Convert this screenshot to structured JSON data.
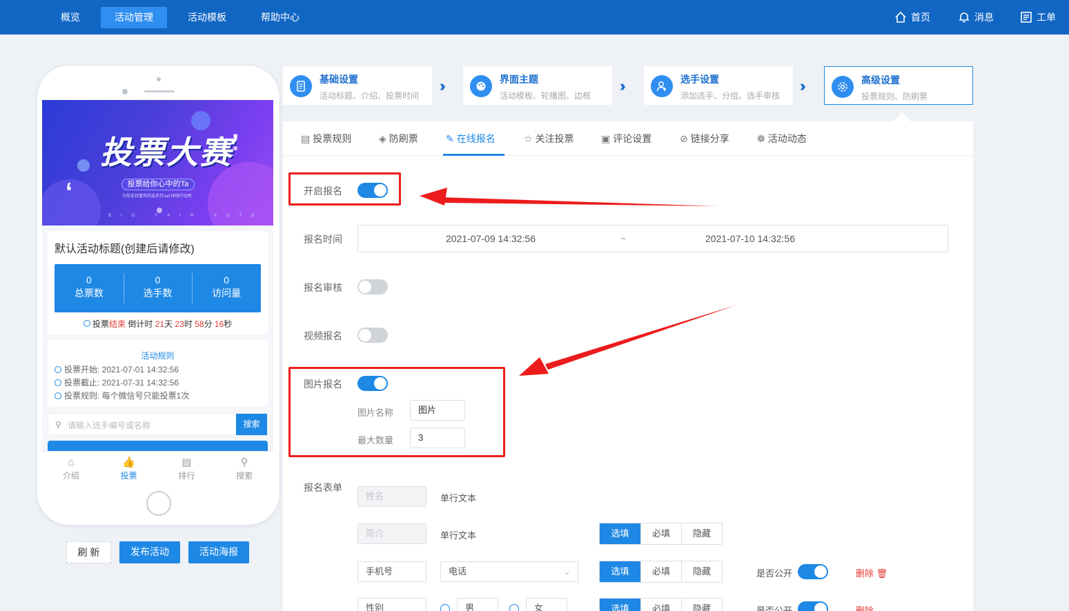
{
  "topnav": {
    "items": [
      "概览",
      "活动管理",
      "活动模板",
      "帮助中心"
    ],
    "active_index": 1,
    "right": {
      "home": "首页",
      "messages": "消息",
      "tickets": "工单"
    }
  },
  "phone": {
    "banner": {
      "title": "投票大赛",
      "pill": "投票给你心中的Ta",
      "sub": "为你支持喜欢的选手打call 快快行动吧",
      "footer": "BIG FAIR VOTE"
    },
    "activity_title": "默认活动标题(创建后请修改)",
    "stats": [
      {
        "value": "0",
        "label": "总票数"
      },
      {
        "value": "0",
        "label": "选手数"
      },
      {
        "value": "0",
        "label": "访问量"
      }
    ],
    "countdown": {
      "prefix": "投票",
      "status": "结束",
      "label": "倒计时",
      "days": "21",
      "days_unit": "天",
      "hours": "23",
      "hours_unit": "时",
      "minutes": "58",
      "minutes_unit": "分",
      "seconds": "16",
      "seconds_unit": "秒"
    },
    "rules": {
      "title": "活动规则",
      "start": "投票开始: 2021-07-01 14:32:56",
      "end": "投票截止: 2021-07-31 14:32:56",
      "rule": "投票规则: 每个微信号只能投票1次"
    },
    "search": {
      "placeholder": "请输入选手编号或名称",
      "button": "搜索"
    },
    "tabbar": [
      "介绍",
      "投票",
      "排行",
      "搜索"
    ]
  },
  "actions": {
    "refresh": "刷 新",
    "publish": "发布活动",
    "poster": "活动海报"
  },
  "steps": [
    {
      "title": "基础设置",
      "desc": "活动标题、介绍、投票时间"
    },
    {
      "title": "界面主题",
      "desc": "活动模板、轮播图、边框"
    },
    {
      "title": "选手设置",
      "desc": "添加选手、分组、选手审核"
    },
    {
      "title": "高级设置",
      "desc": "投票规则、防刷票"
    }
  ],
  "tabs": [
    "投票规则",
    "防刷票",
    "在线报名",
    "关注投票",
    "评论设置",
    "链接分享",
    "活动动态"
  ],
  "active_tab": 2,
  "form": {
    "enable_signup": {
      "label": "开启报名",
      "on": true
    },
    "signup_time": {
      "label": "报名时间",
      "start": "2021-07-09 14:32:56",
      "sep": "~",
      "end": "2021-07-10 14:32:56"
    },
    "review": {
      "label": "报名审核",
      "on": false
    },
    "video": {
      "label": "视频报名",
      "on": false
    },
    "image": {
      "label": "图片报名",
      "on": true,
      "name_label": "图片名称",
      "name_value": "图片",
      "max_label": "最大数量",
      "max_value": "3"
    },
    "signup_form": {
      "label": "报名表单",
      "rows": [
        {
          "field": "姓名",
          "type": "单行文本"
        },
        {
          "field": "简介",
          "type": "单行文本",
          "options": [
            "选填",
            "必填",
            "隐藏"
          ]
        },
        {
          "field": "手机号",
          "type": "电话",
          "options": [
            "选填",
            "必填",
            "隐藏"
          ],
          "public_label": "是否公开",
          "delete": "删除"
        },
        {
          "field": "性别",
          "opt1": "男",
          "opt2": "女",
          "options": [
            "选填",
            "必填",
            "隐藏"
          ],
          "public_label": "是否公开",
          "delete": "删除"
        }
      ]
    }
  },
  "colors": {
    "primary": "#1e88e5",
    "topbar": "#1166c4",
    "annotation": "#ec1c1c"
  }
}
